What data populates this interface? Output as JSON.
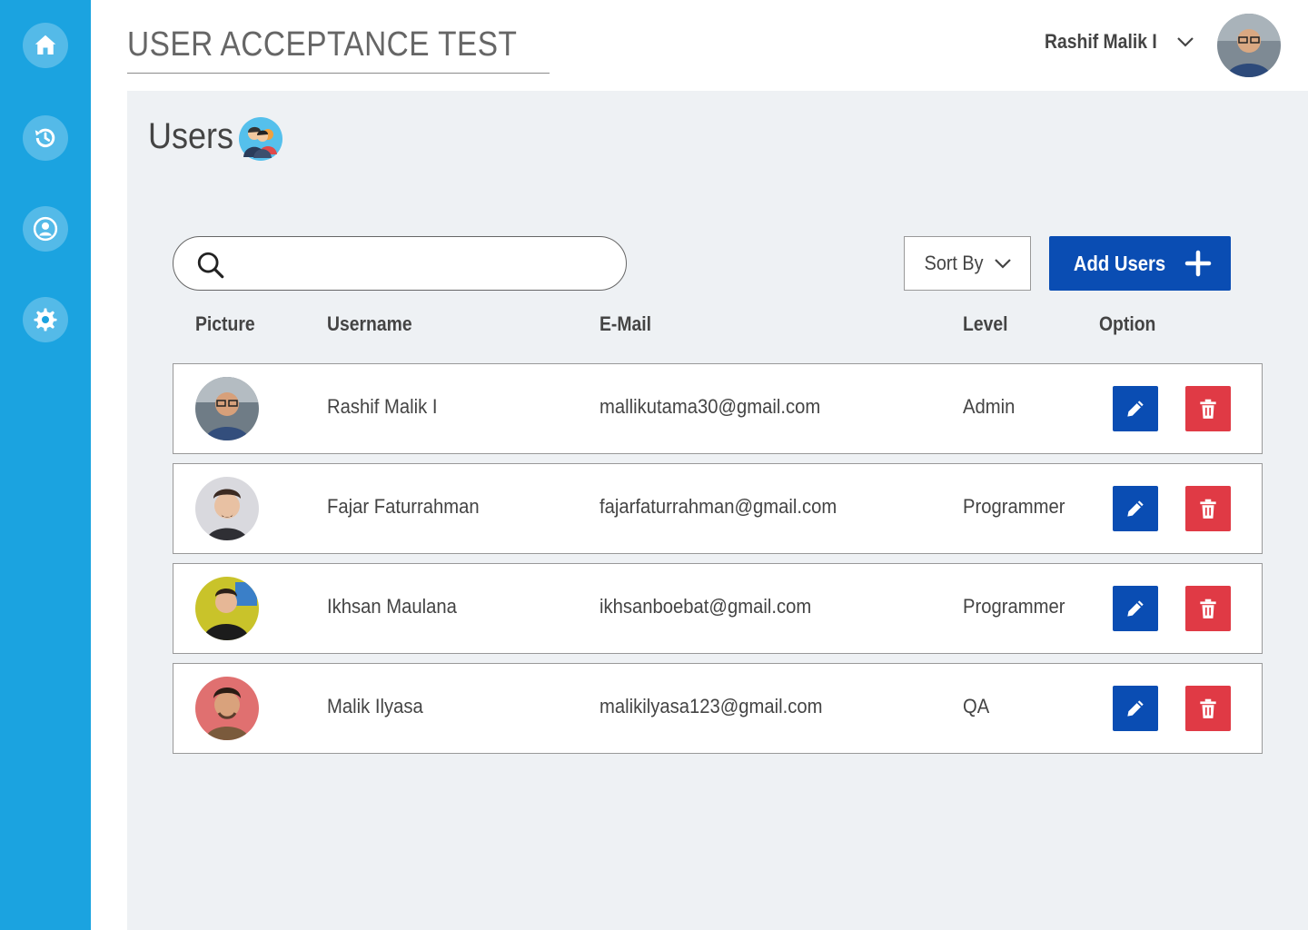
{
  "app": {
    "title": "USER ACCEPTANCE TEST"
  },
  "colors": {
    "sidebar": "#1ba3e0",
    "primary": "#0a4db3",
    "danger": "#e03a45",
    "background": "#eef1f4"
  },
  "sidebar": {
    "items": [
      {
        "icon": "home-icon"
      },
      {
        "icon": "history-icon"
      },
      {
        "icon": "user-icon"
      },
      {
        "icon": "gear-icon"
      }
    ]
  },
  "header": {
    "user_name": "Rashif Malik I"
  },
  "page": {
    "title": "Users"
  },
  "search": {
    "placeholder": ""
  },
  "toolbar": {
    "sort_label": "Sort By",
    "add_label": "Add Users"
  },
  "table": {
    "headers": [
      "Picture",
      "Username",
      "E-Mail",
      "Level",
      "Option"
    ],
    "rows": [
      {
        "username": "Rashif Malik I",
        "email": "mallikutama30@gmail.com",
        "level": "Admin"
      },
      {
        "username": "Fajar Faturrahman",
        "email": "fajarfaturrahman@gmail.com",
        "level": "Programmer"
      },
      {
        "username": "Ikhsan Maulana",
        "email": "ikhsanboebat@gmail.com",
        "level": "Programmer"
      },
      {
        "username": "Malik Ilyasa",
        "email": "malikilyasa123@gmail.com",
        "level": "QA"
      }
    ]
  }
}
